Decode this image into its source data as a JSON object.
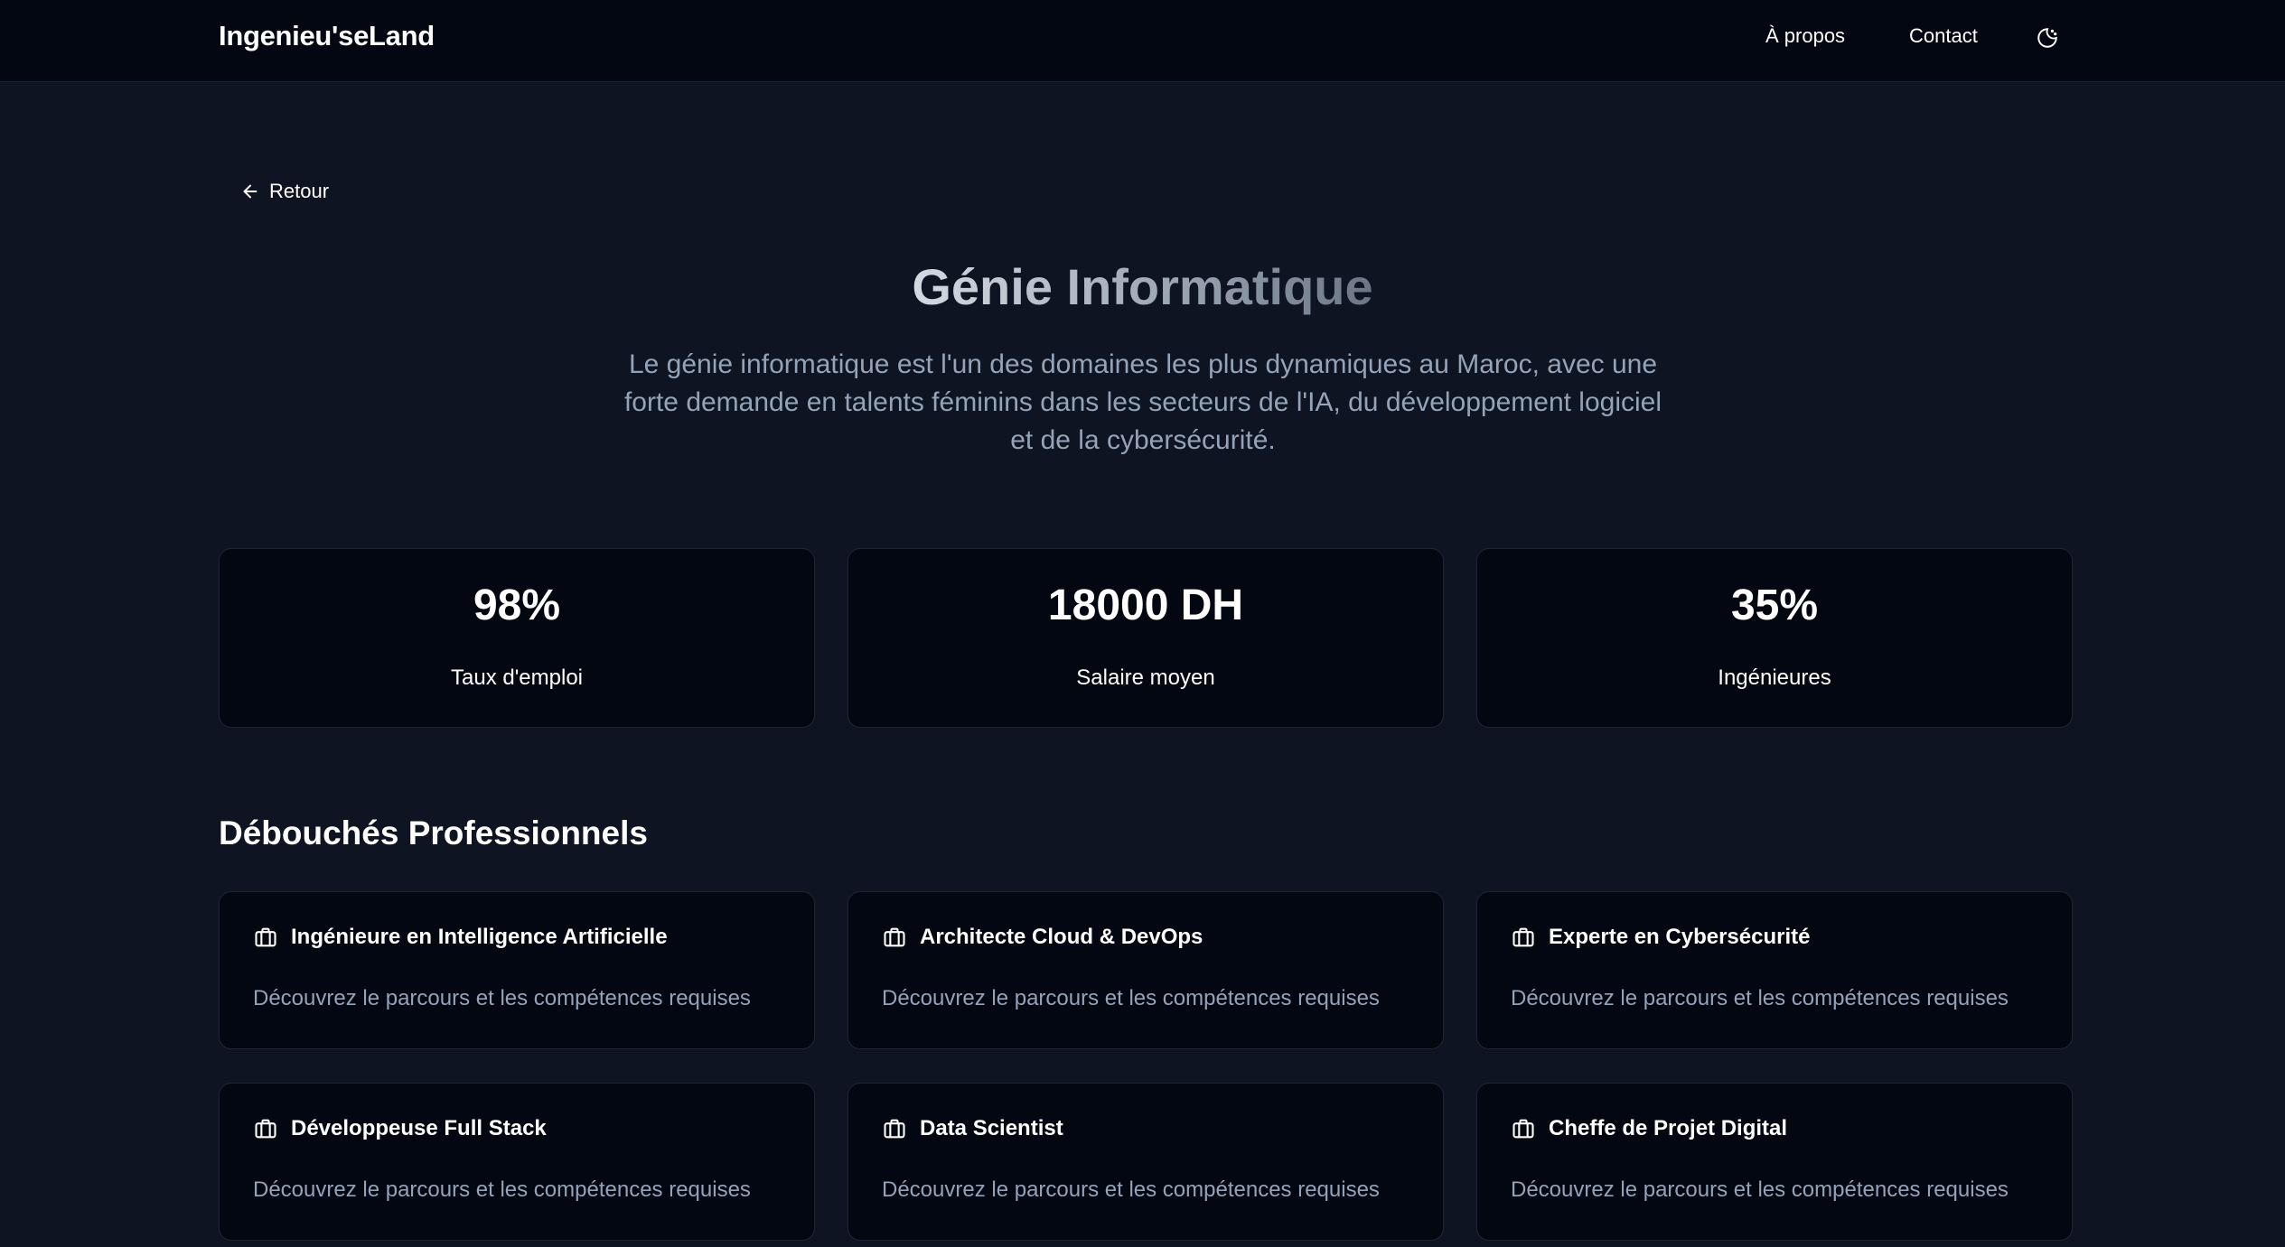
{
  "navbar": {
    "brand": "Ingenieu'seLand",
    "links": [
      "À propos",
      "Contact"
    ],
    "theme_toggle_icon": "moon-sun-icon"
  },
  "back": {
    "label": "Retour",
    "icon": "arrow-left-icon"
  },
  "hero": {
    "title": "Génie Informatique",
    "description": "Le génie informatique est l'un des domaines les plus dynamiques au Maroc, avec une forte demande en talents féminins dans les secteurs de l'IA, du développement logiciel et de la cybersécurité."
  },
  "stats": [
    {
      "value": "98%",
      "label": "Taux d'emploi"
    },
    {
      "value": "18000 DH",
      "label": "Salaire moyen"
    },
    {
      "value": "35%",
      "label": "Ingénieures"
    }
  ],
  "careers": {
    "title": "Débouchés Professionnels",
    "icon": "briefcase-icon",
    "items": [
      {
        "title": "Ingénieure en Intelligence Artificielle",
        "desc": "Découvrez le parcours et les compétences requises"
      },
      {
        "title": "Architecte Cloud & DevOps",
        "desc": "Découvrez le parcours et les compétences requises"
      },
      {
        "title": "Experte en Cybersécurité",
        "desc": "Découvrez le parcours et les compétences requises"
      },
      {
        "title": "Développeuse Full Stack",
        "desc": "Découvrez le parcours et les compétences requises"
      },
      {
        "title": "Data Scientist",
        "desc": "Découvrez le parcours et les compétences requises"
      },
      {
        "title": "Cheffe de Projet Digital",
        "desc": "Découvrez le parcours et les compétences requises"
      }
    ]
  },
  "colors": {
    "page_bg": "#0e1421",
    "card_bg": "#030712",
    "muted_text": "#94a3b8"
  }
}
